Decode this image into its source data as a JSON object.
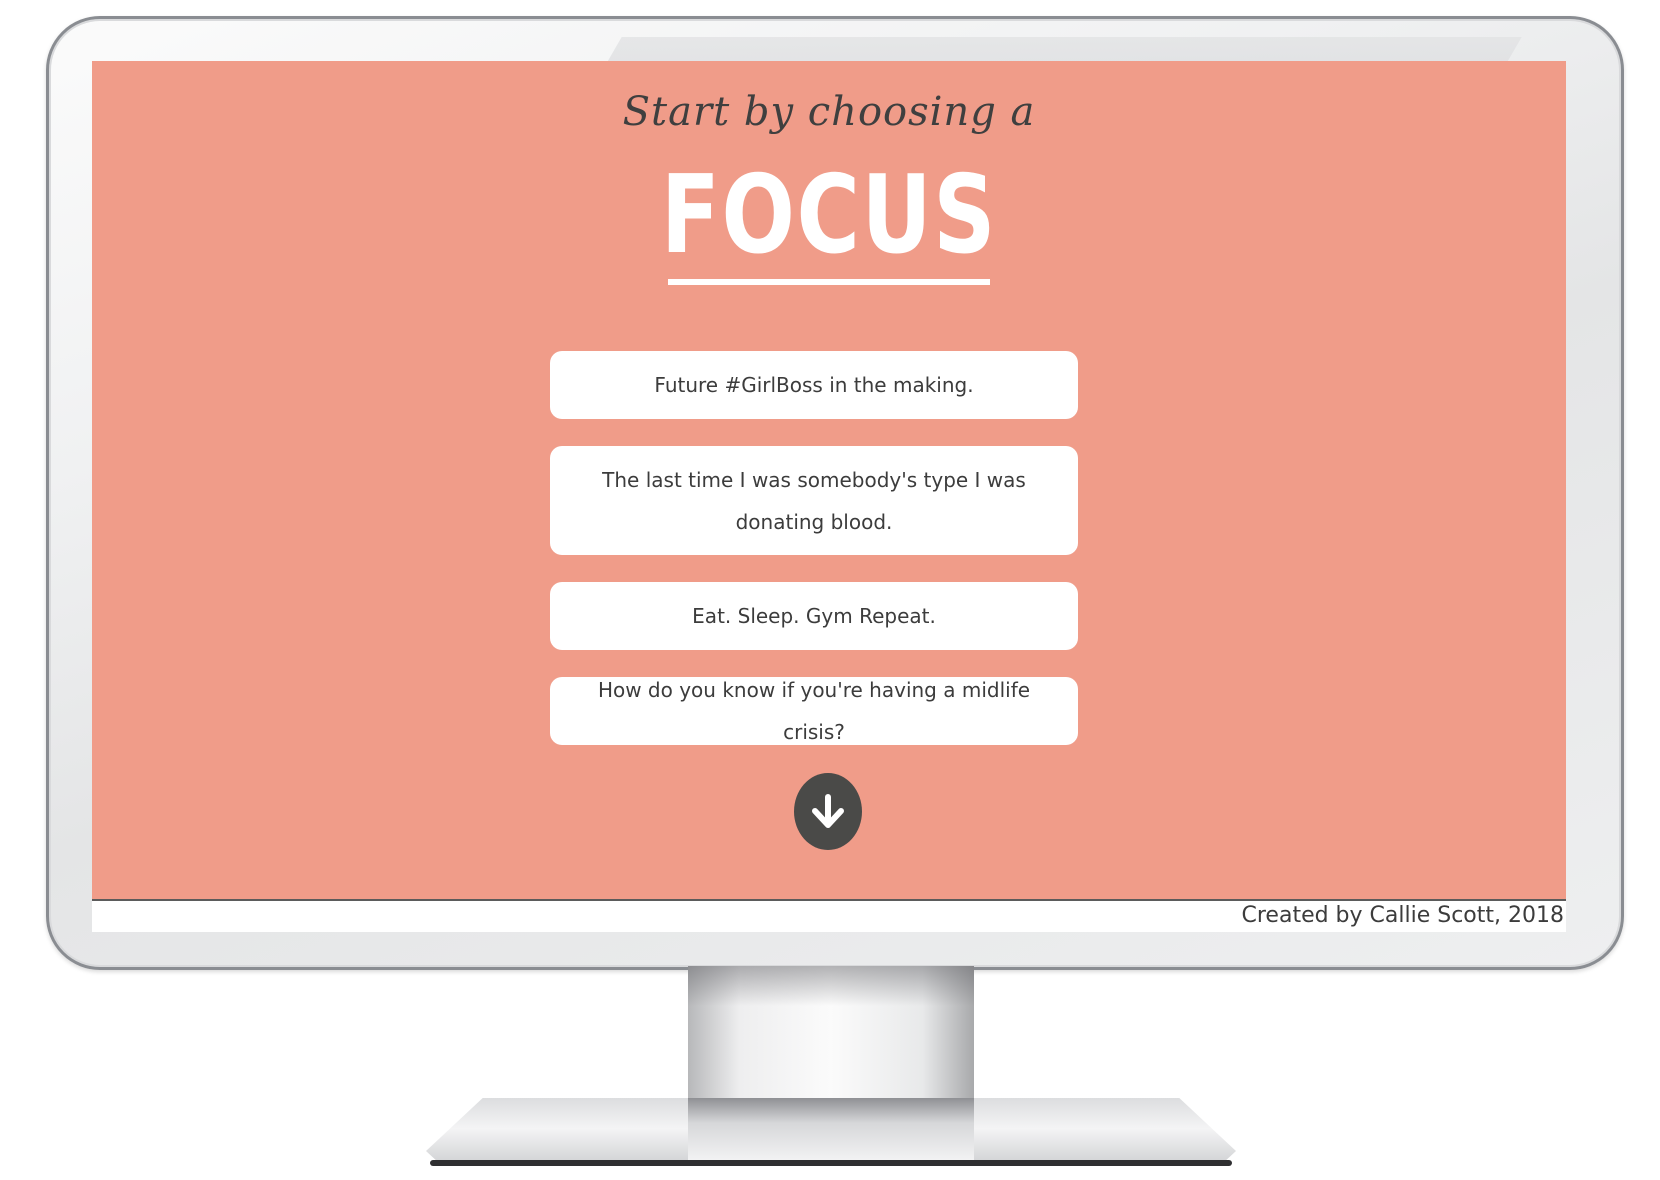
{
  "page": {
    "intro": "Start by choosing a",
    "title": "FOCUS",
    "options": [
      "Future #GirlBoss in the making.",
      "The last time I was somebody's type I was donating blood.",
      "Eat. Sleep. Gym Repeat.",
      "How do you know if you're having a midlife crisis?"
    ],
    "scroll_icon": "arrow-down-circle-icon"
  },
  "footer": {
    "credit": "Created by Callie Scott, 2018"
  },
  "colors": {
    "background": "#f09c89",
    "card": "#ffffff",
    "text_dark": "#3c3c3c",
    "arrow_circle": "#4a4a48",
    "title": "#ffffff"
  }
}
